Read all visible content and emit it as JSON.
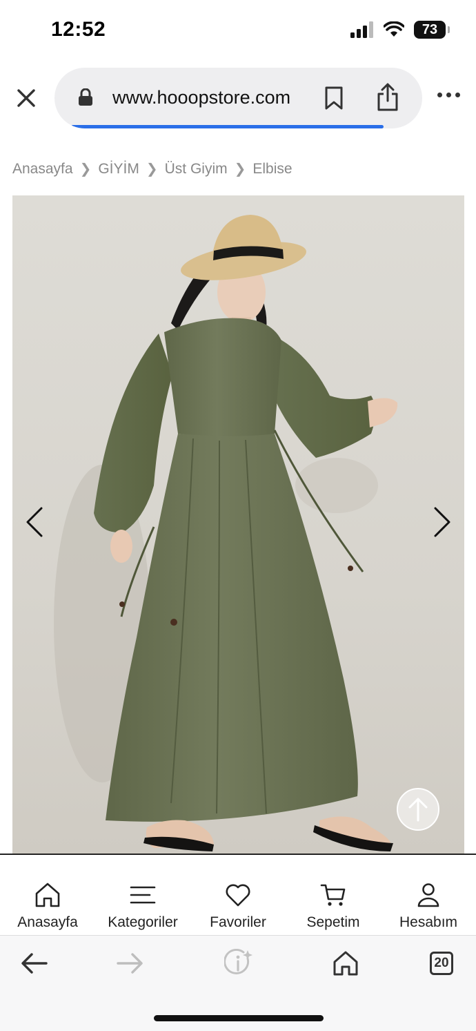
{
  "status_bar": {
    "time": "12:52",
    "battery_level": "73",
    "icons": [
      "cellular-signal-icon",
      "wifi-icon",
      "battery-icon"
    ]
  },
  "browser": {
    "url": "www.hooopstore.com",
    "load_progress_fraction": 0.85,
    "icons": [
      "close-icon",
      "lock-icon",
      "bookmark-icon",
      "share-icon",
      "more-icon"
    ]
  },
  "breadcrumb": {
    "items": [
      "Anasayfa",
      "GİYİM",
      "Üst Giyim",
      "Elbise"
    ],
    "separator_icon": "chevron-right-icon"
  },
  "product_gallery": {
    "image": "model-in-olive-green-long-sleeve-maxi-dress-and-straw-hat",
    "icons": [
      "chevron-left-icon",
      "chevron-right-icon",
      "arrow-up-icon"
    ]
  },
  "site_nav": {
    "items": [
      {
        "label": "Anasayfa",
        "icon": "home-icon"
      },
      {
        "label": "Kategoriler",
        "icon": "menu-icon"
      },
      {
        "label": "Favoriler",
        "icon": "heart-icon"
      },
      {
        "label": "Sepetim",
        "icon": "cart-icon"
      },
      {
        "label": "Hesabım",
        "icon": "user-icon"
      }
    ]
  },
  "browser_toolbar": {
    "tabs_count": "20",
    "icons": [
      "back-arrow-icon",
      "forward-arrow-icon",
      "page-info-icon",
      "home-icon",
      "tabs-icon"
    ]
  },
  "colors": {
    "progress_blue": "#2a6ee8",
    "dress_olive": "#6b7356",
    "url_pill_bg": "#eeeef0"
  }
}
